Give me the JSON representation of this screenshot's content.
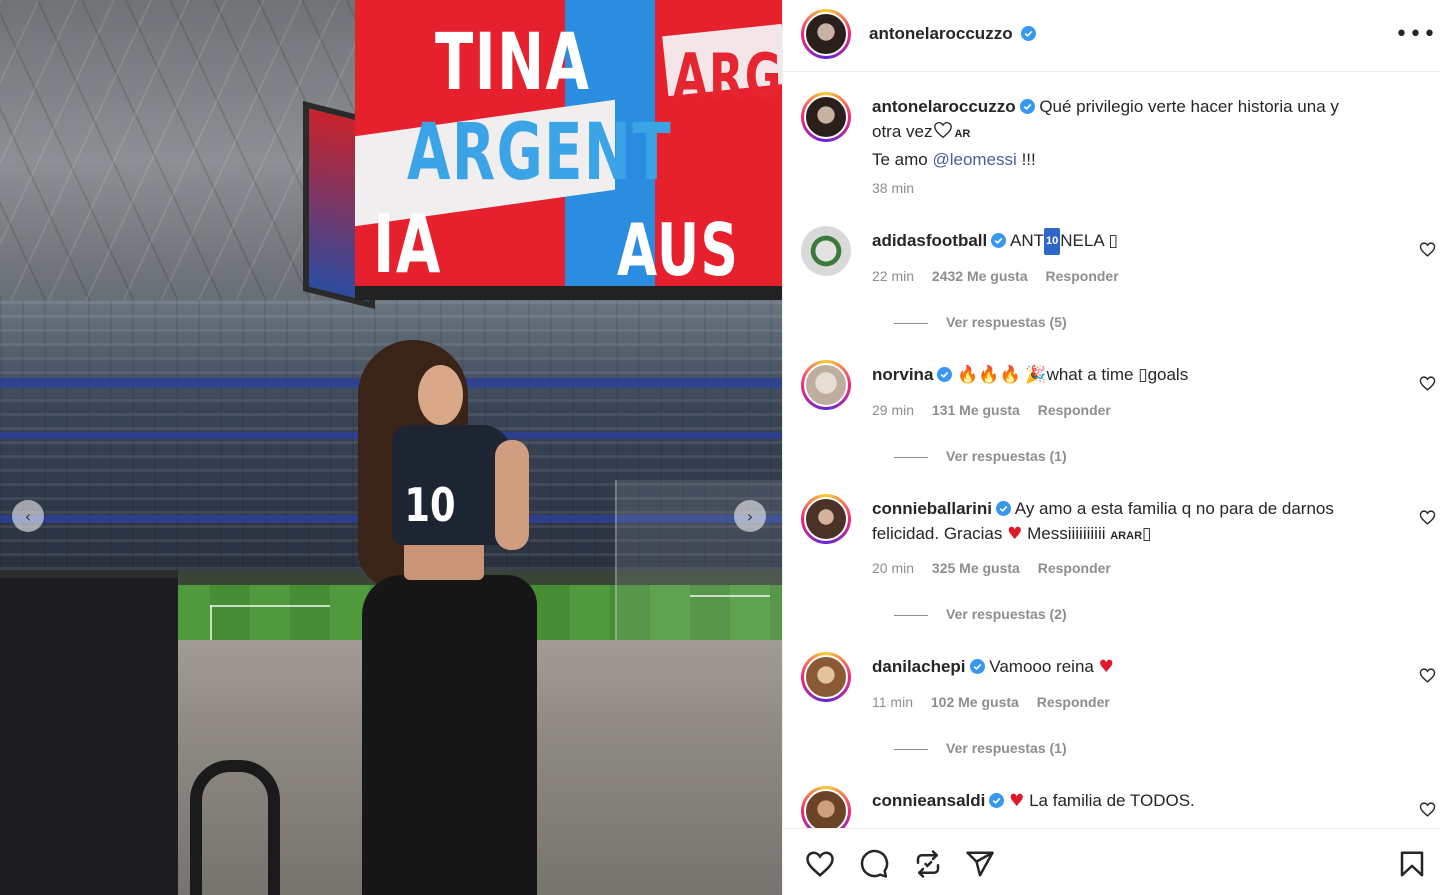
{
  "post": {
    "author": "antonelaroccuzzo",
    "more_label": "•••",
    "caption_line1": "Qué privilegio verte hacer historia una y",
    "caption_line2": "otra vez",
    "caption_flag": "AR",
    "caption_line3_prefix": "Te amo",
    "caption_mention": "@leomessi",
    "caption_line3_suffix": "!!!",
    "caption_time": "38 min"
  },
  "photo": {
    "screen_text_1": "TINA",
    "screen_text_2": "ARGENT",
    "screen_text_3": "IA",
    "screen_text_4": "AUS",
    "screen_text_5": "ARG",
    "jersey_number": "10",
    "prev_arrow": "‹",
    "next_arrow": "›"
  },
  "comments": [
    {
      "user": "adidasfootball",
      "text_a": "ANT",
      "badge": "10",
      "text_b": "NELA",
      "text_c": "▯",
      "time": "22 min",
      "likes": "2432 Me gusta",
      "reply": "Responder",
      "replies": "Ver respuestas (5)"
    },
    {
      "user": "norvina",
      "emojis": "🔥🔥🔥",
      "party": "🎉",
      "text": "what a time ▯goals",
      "time": "29 min",
      "likes": "131 Me gusta",
      "reply": "Responder",
      "replies": "Ver respuestas (1)"
    },
    {
      "user": "connieballarini",
      "text_line1": "Ay amo a esta familia q no para de darnos",
      "text_line2a": "felicidad. Gracias",
      "text_line2b": "Messiiiiiiiiii",
      "text_flags": "ARAR",
      "text_end": "▯",
      "time": "20 min",
      "likes": "325 Me gusta",
      "reply": "Responder",
      "replies": "Ver respuestas (2)"
    },
    {
      "user": "danilachepi",
      "text": "Vamooo reina",
      "time": "11 min",
      "likes": "102 Me gusta",
      "reply": "Responder",
      "replies": "Ver respuestas (1)"
    },
    {
      "user": "connieansaldi",
      "text": "La familia de TODOS."
    }
  ],
  "icons": {
    "heart": "♥",
    "verified_color": "#3897f0",
    "like_icon": "heart-outline",
    "comment_icon": "speech-bubble",
    "share_icon": "repost-arrows",
    "send_icon": "paper-plane",
    "save_icon": "bookmark"
  }
}
